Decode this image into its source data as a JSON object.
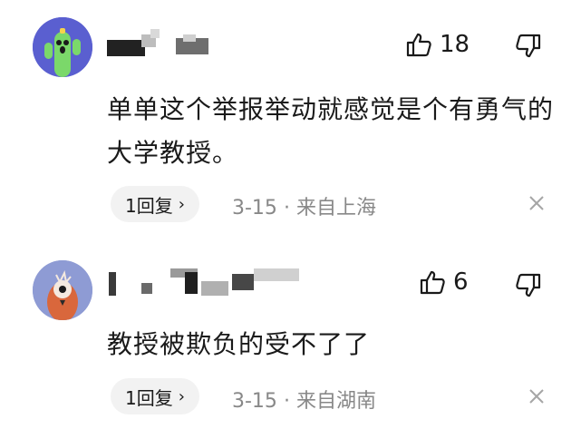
{
  "comments": [
    {
      "like_count": "18",
      "text": "单单这个举报举动就感觉是个有勇气的大学教授。",
      "reply_label": "1回复",
      "reply_chevron": "›",
      "date": "3-15",
      "separator": "·",
      "location": "来自上海",
      "avatar_icon": "cactus-avatar-icon"
    },
    {
      "like_count": "6",
      "text": "教授被欺负的受不了了",
      "reply_label": "1回复",
      "reply_chevron": "›",
      "date": "3-15",
      "separator": "·",
      "location": "来自湖南",
      "avatar_icon": "bird-avatar-icon"
    }
  ],
  "icons": {
    "like": "thumbs-up-icon",
    "dislike": "thumbs-down-icon",
    "close": "close-icon"
  },
  "colors": {
    "meta_text": "#888888",
    "pill_bg": "#f2f2f2",
    "avatar1_bg": "#5a5fd0",
    "avatar2_bg": "#8e9bd4"
  }
}
